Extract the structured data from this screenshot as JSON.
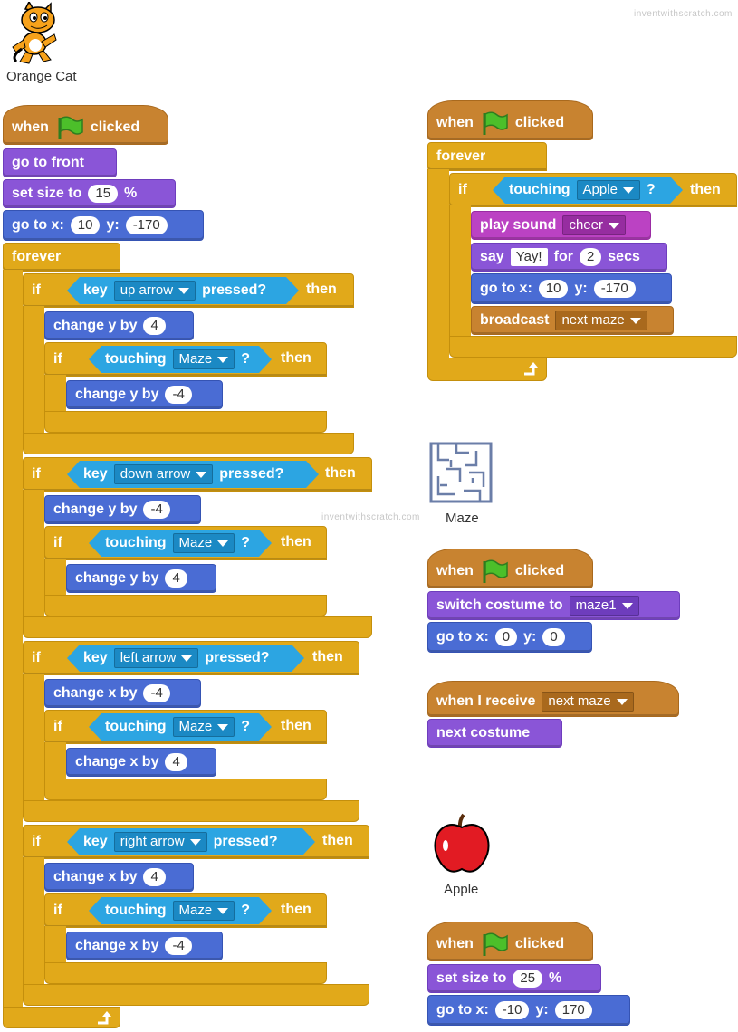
{
  "watermark": "inventwithscratch.com",
  "colors": {
    "events": "#c88330",
    "control": "#e1a91a",
    "looks": "#8a55d7",
    "motion": "#4a6cd4",
    "sound": "#bb42c3",
    "sensing": "#2ca5e2"
  },
  "sprites": {
    "cat": {
      "name": "Orange Cat",
      "icon": "orange-cat-icon"
    },
    "maze": {
      "name": "Maze",
      "icon": "maze-icon"
    },
    "apple": {
      "name": "Apple",
      "icon": "apple-icon"
    }
  },
  "words": {
    "when": "when",
    "clicked": "clicked",
    "go_to_front": "go to front",
    "set_size_to": "set size to",
    "percent": "%",
    "go_to_x": "go to x:",
    "y": "y:",
    "forever": "forever",
    "if": "if",
    "then": "then",
    "key": "key",
    "pressed": "pressed?",
    "touching": "touching",
    "question": "?",
    "change_y_by": "change y by",
    "change_x_by": "change x by",
    "play_sound": "play sound",
    "say": "say",
    "for": "for",
    "secs": "secs",
    "broadcast": "broadcast",
    "switch_costume_to": "switch costume to",
    "when_i_receive": "when I receive",
    "next_costume": "next costume"
  },
  "cat_script": {
    "size": "15",
    "go_x": "10",
    "go_y": "-170",
    "sections": [
      {
        "key": "up arrow",
        "change": "4",
        "touch": "Maze",
        "back": "-4"
      },
      {
        "key": "down arrow",
        "change": "-4",
        "touch": "Maze",
        "back": "4"
      },
      {
        "key": "left arrow",
        "change": "-4",
        "touch": "Maze",
        "back": "4"
      },
      {
        "key": "right arrow",
        "change": "4",
        "touch": "Maze",
        "back": "-4"
      }
    ]
  },
  "cat_script2": {
    "touch": "Apple",
    "sound": "cheer",
    "say_text": "Yay!",
    "say_secs": "2",
    "go_x": "10",
    "go_y": "-170",
    "broadcast": "next maze"
  },
  "maze_script": {
    "costume": "maze1",
    "go_x": "0",
    "go_y": "0",
    "receive": "next maze"
  },
  "apple_script": {
    "size": "25",
    "go_x": "-10",
    "go_y": "170"
  }
}
